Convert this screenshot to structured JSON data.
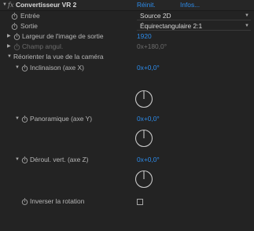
{
  "effect": {
    "name": "Convertisseur VR 2",
    "fx_glyph": "fx",
    "reset_label": "Réinit.",
    "info_label": "Infos..."
  },
  "params": {
    "input": {
      "label": "Entrée",
      "value": "Source 2D"
    },
    "output": {
      "label": "Sortie",
      "value": "Équirectangulaire 2:1"
    },
    "output_width": {
      "label": "Largeur de l'image de sortie",
      "value": "1920"
    },
    "fov": {
      "label": "Champ angul.",
      "value": "0x+180,0°"
    },
    "reorient": {
      "label": "Réorienter la vue de la caméra"
    },
    "tilt": {
      "label": "Inclinaison (axe X)",
      "value": "0x+0,0°",
      "angle_deg": 0
    },
    "pan": {
      "label": "Panoramique (axe Y)",
      "value": "0x+0,0°",
      "angle_deg": 0
    },
    "roll": {
      "label": "Déroul. vert. (axe Z)",
      "value": "0x+0,0°",
      "angle_deg": 0
    },
    "invert_rotation": {
      "label": "Inverser la rotation",
      "checked": false
    }
  },
  "colors": {
    "panel_bg": "#232323",
    "text": "#b8b8b8",
    "value_blue": "#2d8ceb",
    "disabled": "#6d6d6d"
  },
  "icons": {
    "expand": "triangle-down-icon",
    "collapse": "triangle-right-icon",
    "stopwatch": "stopwatch-icon",
    "dial": "angle-dial-icon",
    "dropdown": "chevron-down-icon"
  }
}
